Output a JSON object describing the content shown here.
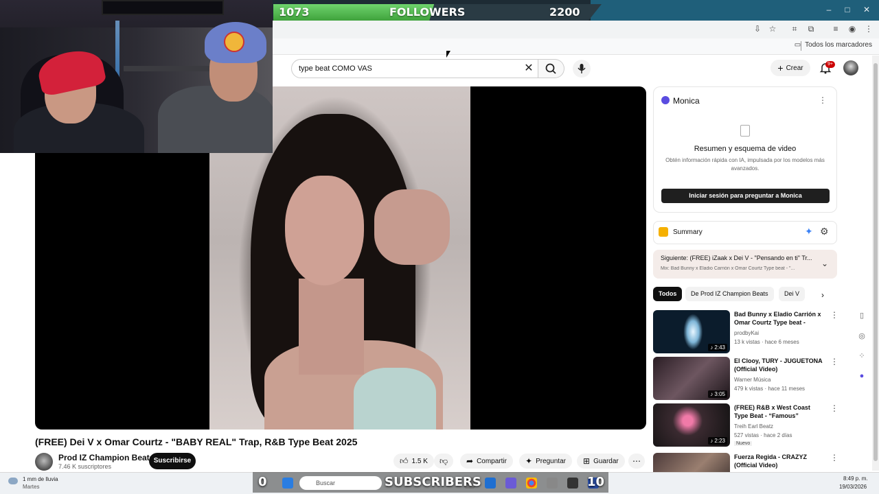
{
  "overlay": {
    "followers_current": "1073",
    "followers_label": "FOLLOWERS",
    "followers_goal": "2200",
    "followers_progress": 0.49,
    "subs_current": "0",
    "subs_label": "SUBSCRIBERS",
    "subs_goal": "10"
  },
  "browser": {
    "bookmarks_folder": "Todos los marcadores"
  },
  "header": {
    "search_value": "type beat COMO VAS",
    "create_label": "Crear",
    "notif_badge": "9+"
  },
  "video": {
    "title": "(FREE) Dei V x Omar Courtz - \"BABY REAL\" Trap, R&B Type Beat 2025",
    "channel": "Prod IZ Champion Beats",
    "subscribers": "7.46 K suscriptores",
    "subscribe_label": "Suscribirse",
    "likes": "1.5 K",
    "share_label": "Compartir",
    "ask_label": "Preguntar",
    "save_label": "Guardar"
  },
  "monica": {
    "title": "Monica",
    "heading": "Resumen y esquema de video",
    "description": "Obtén información rápida con IA, impulsada por los modelos más avanzados.",
    "login_label": "Iniciar sesión para preguntar a Monica"
  },
  "summary": {
    "label": "Summary"
  },
  "next_up": {
    "title": "Siguiente: (FREE) iZaak x Dei V - \"Pensando en ti\" Tr...",
    "subtitle": "Mix: Bad Bunny x Eladio Carrión x Omar Courtz Type beat - \"..."
  },
  "chips": [
    "Todos",
    "De Prod IZ Champion Beats",
    "Dei V"
  ],
  "related": [
    {
      "title": "Bad Bunny x Eladio Carrión x Omar Courtz Type beat - \"CO...",
      "channel": "prodbyKai",
      "meta": "13 k vistas · hace 6 meses",
      "duration": "2:43",
      "badge": ""
    },
    {
      "title": "El Clooy, TURY - JUGUETONA (Official Video)",
      "channel": "Warner Música",
      "meta": "479 k vistas · hace 11 meses",
      "duration": "3:05",
      "badge": ""
    },
    {
      "title": "(FREE) R&B x West Coast Type Beat - “Famous”",
      "channel": "Treih Earl Beatz",
      "meta": "527 vistas · hace 2 días",
      "duration": "2:23",
      "badge": "Nuevo"
    },
    {
      "title": "Fuerza Regida - CRAZYZ (Official Video)",
      "channel": "",
      "meta": "",
      "duration": "",
      "badge": ""
    }
  ],
  "taskbar": {
    "weather_line1": "1 mm de lluvia",
    "weather_line2": "Martes",
    "search_placeholder": "Buscar",
    "time": "8:49 p. m.",
    "date": "19/03/2026"
  }
}
